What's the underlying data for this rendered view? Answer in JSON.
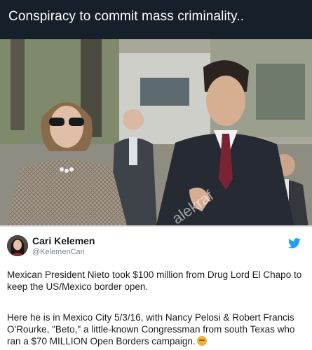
{
  "caption": {
    "text": "Conspiracy to commit mass criminality.."
  },
  "photo": {
    "watermark": "alekraf"
  },
  "tweet": {
    "author_name": "Cari Kelemen",
    "author_handle": "@KelemenCari",
    "paragraph_1": "Mexican President Nieto took $100 million from Drug Lord El Chapo to keep the US/Mexico border open.",
    "paragraph_2": "Here he is in Mexico City 5/3/16, with Nancy Pelosi & Robert Francis O'Rourke, \"Beto,\" a little-known Congressman from south Texas who ran a  $70 MILLION Open Borders campaign.",
    "emoji": "thinking-face",
    "brand_icon": "twitter-bird-icon"
  },
  "colors": {
    "top_bar": "#15202b",
    "twitter_blue": "#1da1f2",
    "card_bg": "#ffffff"
  }
}
